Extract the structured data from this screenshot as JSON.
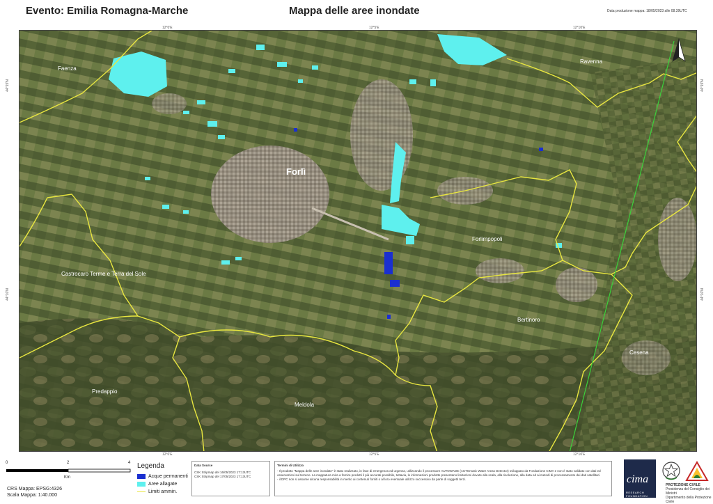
{
  "header": {
    "event": "Evento: Emilia Romagna-Marche",
    "title": "Mappa delle aree inondate",
    "production_date": "Data produzione mappa: 18/05/2023 alle 08.39UTC"
  },
  "map": {
    "places": {
      "faenza": "Faenza",
      "ravenna": "Ravenna",
      "forli": "Forlì",
      "forlimpopoli": "Forlimpopoli",
      "castrocaro": "Castrocaro Terme e Terra del Sole",
      "bertinoro": "Bertinoro",
      "cesena": "Cesena",
      "predappio": "Predappio",
      "meldola": "Meldola"
    },
    "top_coords": [
      "12°0'E",
      "12°5'E",
      "12°10'E"
    ],
    "bottom_coords": [
      "12°0'E",
      "12°5'E",
      "12°10'E"
    ],
    "left_coords": [
      "44°15'N",
      "44°10'N"
    ],
    "right_coords": [
      "44°15'N",
      "44°10'N"
    ],
    "north_arrow": "north-arrow-icon"
  },
  "scale": {
    "ticks": [
      "0",
      "2",
      "4"
    ],
    "unit": "Km"
  },
  "crs": {
    "line1": "CRS Mappa: EPSG:4326",
    "line2": "Scala Mappa:   1:40.000"
  },
  "legend": {
    "title": "Legenda",
    "items": [
      {
        "label": "Acque permanenti",
        "color": "#1a2fd0"
      },
      {
        "label": "Aree allagate",
        "color": "#5ef0ee"
      },
      {
        "label": "Limiti ammin.",
        "color": "#e8e640"
      }
    ]
  },
  "data_source": {
    "title": "Data Source",
    "line1": "CSK Stripmap del 16/05/2023 17:13UTC",
    "line2": "CSK Stripmap del 17/05/2023 17:13UTC"
  },
  "terms": {
    "title": "Termini di Utilizzo",
    "p1": "- Il prodotto \"Mappa delle aree inondate\" è stato realizzato, in fase di emergenza ed urgenza, utilizzando il processore AUTOWADE (AUTOmatic Water Areas Detector) sviluppato da Fondazione CIMA e non è stato validato con dati ed osservazioni sul terreno. La mappatura mira a fornire prodotti il più accurati possibile, tuttavia, le informazioni prodotte presentano limitazioni dovute alla scala, alla risoluzione, alla data ed ai metodi di processamento dei dati satellitari.",
    "p2": "- il DPC non si assume alcuna responsabilità in merito ai contenuti forniti o al loro eventuale utilizzo successivo da parte di soggetti terzi."
  },
  "logos": {
    "cima": "cima",
    "cima_sub": "RESEARCH FOUNDATION",
    "pc_line1": "PROTEZIONE CIVILE",
    "pc_line2": "Presidenza del Consiglio dei Ministri",
    "pc_line3": "Dipartimento della Protezione Civile"
  }
}
